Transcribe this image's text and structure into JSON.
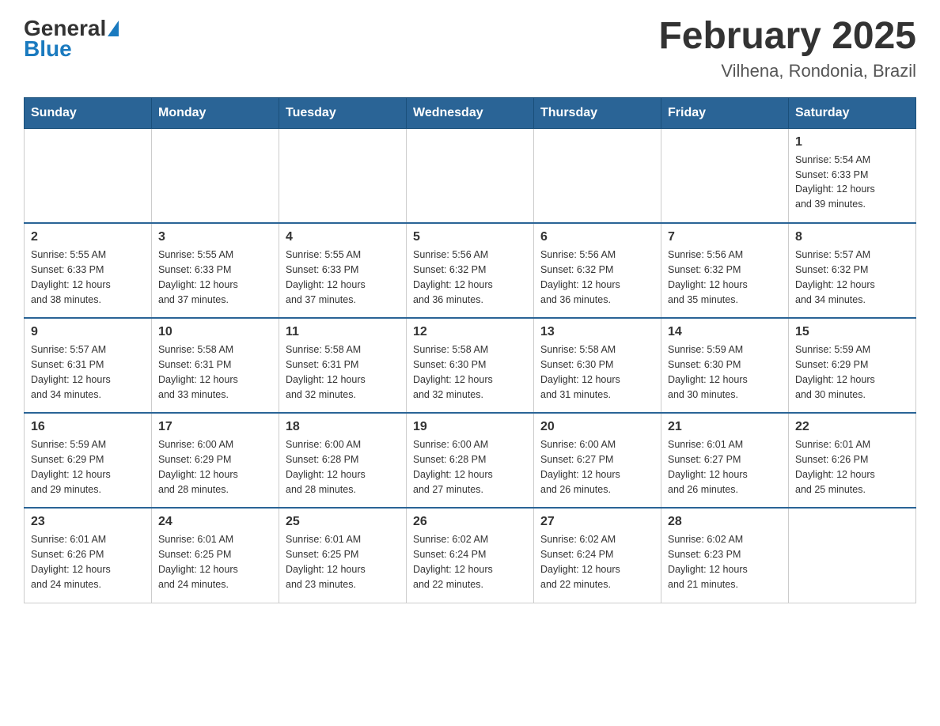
{
  "header": {
    "logo_general": "General",
    "logo_blue": "Blue",
    "month_year": "February 2025",
    "location": "Vilhena, Rondonia, Brazil"
  },
  "weekdays": [
    "Sunday",
    "Monday",
    "Tuesday",
    "Wednesday",
    "Thursday",
    "Friday",
    "Saturday"
  ],
  "weeks": [
    [
      {
        "day": "",
        "info": ""
      },
      {
        "day": "",
        "info": ""
      },
      {
        "day": "",
        "info": ""
      },
      {
        "day": "",
        "info": ""
      },
      {
        "day": "",
        "info": ""
      },
      {
        "day": "",
        "info": ""
      },
      {
        "day": "1",
        "info": "Sunrise: 5:54 AM\nSunset: 6:33 PM\nDaylight: 12 hours\nand 39 minutes."
      }
    ],
    [
      {
        "day": "2",
        "info": "Sunrise: 5:55 AM\nSunset: 6:33 PM\nDaylight: 12 hours\nand 38 minutes."
      },
      {
        "day": "3",
        "info": "Sunrise: 5:55 AM\nSunset: 6:33 PM\nDaylight: 12 hours\nand 37 minutes."
      },
      {
        "day": "4",
        "info": "Sunrise: 5:55 AM\nSunset: 6:33 PM\nDaylight: 12 hours\nand 37 minutes."
      },
      {
        "day": "5",
        "info": "Sunrise: 5:56 AM\nSunset: 6:32 PM\nDaylight: 12 hours\nand 36 minutes."
      },
      {
        "day": "6",
        "info": "Sunrise: 5:56 AM\nSunset: 6:32 PM\nDaylight: 12 hours\nand 36 minutes."
      },
      {
        "day": "7",
        "info": "Sunrise: 5:56 AM\nSunset: 6:32 PM\nDaylight: 12 hours\nand 35 minutes."
      },
      {
        "day": "8",
        "info": "Sunrise: 5:57 AM\nSunset: 6:32 PM\nDaylight: 12 hours\nand 34 minutes."
      }
    ],
    [
      {
        "day": "9",
        "info": "Sunrise: 5:57 AM\nSunset: 6:31 PM\nDaylight: 12 hours\nand 34 minutes."
      },
      {
        "day": "10",
        "info": "Sunrise: 5:58 AM\nSunset: 6:31 PM\nDaylight: 12 hours\nand 33 minutes."
      },
      {
        "day": "11",
        "info": "Sunrise: 5:58 AM\nSunset: 6:31 PM\nDaylight: 12 hours\nand 32 minutes."
      },
      {
        "day": "12",
        "info": "Sunrise: 5:58 AM\nSunset: 6:30 PM\nDaylight: 12 hours\nand 32 minutes."
      },
      {
        "day": "13",
        "info": "Sunrise: 5:58 AM\nSunset: 6:30 PM\nDaylight: 12 hours\nand 31 minutes."
      },
      {
        "day": "14",
        "info": "Sunrise: 5:59 AM\nSunset: 6:30 PM\nDaylight: 12 hours\nand 30 minutes."
      },
      {
        "day": "15",
        "info": "Sunrise: 5:59 AM\nSunset: 6:29 PM\nDaylight: 12 hours\nand 30 minutes."
      }
    ],
    [
      {
        "day": "16",
        "info": "Sunrise: 5:59 AM\nSunset: 6:29 PM\nDaylight: 12 hours\nand 29 minutes."
      },
      {
        "day": "17",
        "info": "Sunrise: 6:00 AM\nSunset: 6:29 PM\nDaylight: 12 hours\nand 28 minutes."
      },
      {
        "day": "18",
        "info": "Sunrise: 6:00 AM\nSunset: 6:28 PM\nDaylight: 12 hours\nand 28 minutes."
      },
      {
        "day": "19",
        "info": "Sunrise: 6:00 AM\nSunset: 6:28 PM\nDaylight: 12 hours\nand 27 minutes."
      },
      {
        "day": "20",
        "info": "Sunrise: 6:00 AM\nSunset: 6:27 PM\nDaylight: 12 hours\nand 26 minutes."
      },
      {
        "day": "21",
        "info": "Sunrise: 6:01 AM\nSunset: 6:27 PM\nDaylight: 12 hours\nand 26 minutes."
      },
      {
        "day": "22",
        "info": "Sunrise: 6:01 AM\nSunset: 6:26 PM\nDaylight: 12 hours\nand 25 minutes."
      }
    ],
    [
      {
        "day": "23",
        "info": "Sunrise: 6:01 AM\nSunset: 6:26 PM\nDaylight: 12 hours\nand 24 minutes."
      },
      {
        "day": "24",
        "info": "Sunrise: 6:01 AM\nSunset: 6:25 PM\nDaylight: 12 hours\nand 24 minutes."
      },
      {
        "day": "25",
        "info": "Sunrise: 6:01 AM\nSunset: 6:25 PM\nDaylight: 12 hours\nand 23 minutes."
      },
      {
        "day": "26",
        "info": "Sunrise: 6:02 AM\nSunset: 6:24 PM\nDaylight: 12 hours\nand 22 minutes."
      },
      {
        "day": "27",
        "info": "Sunrise: 6:02 AM\nSunset: 6:24 PM\nDaylight: 12 hours\nand 22 minutes."
      },
      {
        "day": "28",
        "info": "Sunrise: 6:02 AM\nSunset: 6:23 PM\nDaylight: 12 hours\nand 21 minutes."
      },
      {
        "day": "",
        "info": ""
      }
    ]
  ]
}
